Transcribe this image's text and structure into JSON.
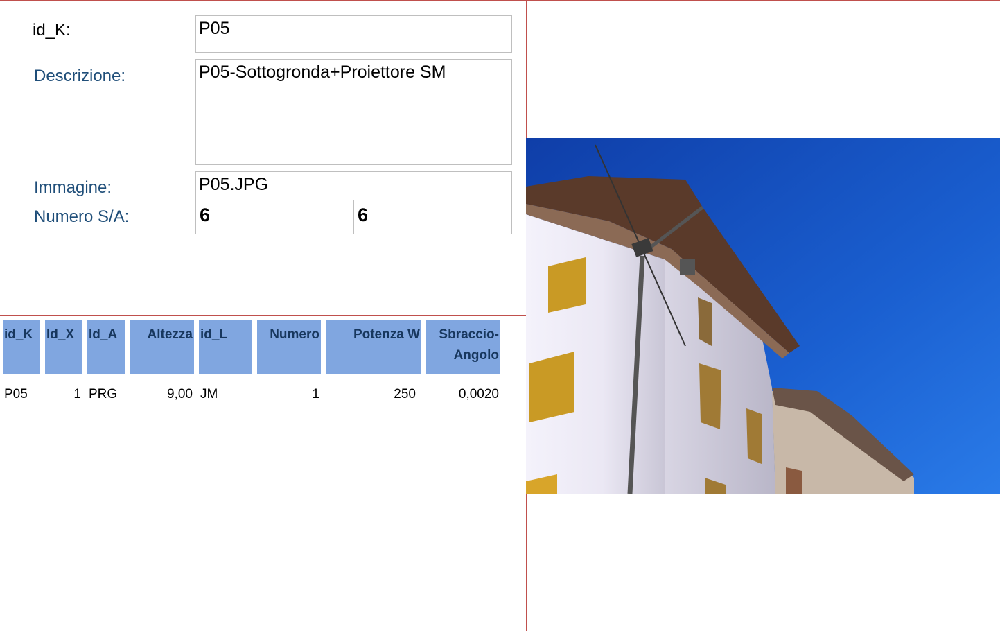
{
  "form": {
    "id_k": {
      "label": "id_K:",
      "value": "P05"
    },
    "descrizione": {
      "label": "Descrizione:",
      "value": "P05-Sottogronda+Proiettore SM"
    },
    "immagine": {
      "label": "Immagine:",
      "value": "P05.JPG"
    },
    "numero_sa": {
      "label": "Numero S/A:",
      "value_s": "6",
      "value_a": "6"
    }
  },
  "table": {
    "headers": {
      "id_k": "id_K",
      "id_x": "Id_X",
      "id_a": "Id_A",
      "altezza": "Altezza",
      "id_l": "id_L",
      "numero": "Numero",
      "potenza": "Potenza W",
      "sbraccio_1": "Sbraccio-",
      "sbraccio_2": "Angolo"
    },
    "rows": [
      {
        "id_k": "P05",
        "id_x": "1",
        "id_a": "PRG",
        "altezza": "9,00",
        "id_l": "JM",
        "numero": "1",
        "potenza": "250",
        "sbraccio": "0,0020"
      }
    ]
  },
  "colors": {
    "accent_line": "#c0504d",
    "label_blue": "#1f4e79",
    "header_fill": "#80a6e0",
    "header_text": "#17375e"
  },
  "icons": {
    "photo": "building-photo"
  }
}
